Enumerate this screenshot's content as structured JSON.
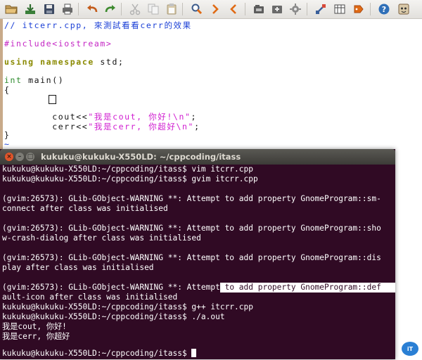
{
  "toolbar": {
    "icons": [
      "open-folder-icon",
      "download-icon",
      "save-icon",
      "print-icon",
      "undo-icon",
      "redo-icon",
      "cut-icon",
      "copy-icon",
      "paste-icon",
      "find-replace-icon",
      "find-next-icon",
      "find-prev-icon",
      "load-session-icon",
      "save-session-icon",
      "run-script-icon",
      "make-icon",
      "shell-icon",
      "ctags-icon",
      "help-icon",
      "vim-help-icon"
    ],
    "colors": {
      "undo": "#c35b1a",
      "find": "#e06a14",
      "help": "#2f6fb8"
    }
  },
  "editor": {
    "lines": {
      "comment": "// itcerr.cpp, 來測試看看cerr的效果",
      "include_kw": "#include",
      "include_hdr": "<iostream>",
      "using_kw": "using",
      "namespace_kw": "namespace",
      "std_text": " std;",
      "int_kw": "int",
      "main_sig": " main()",
      "open_brace": "{",
      "cout_prefix": "        cout<<",
      "cout_str": "\"我是cout, 你好!\\n\"",
      "semi": ";",
      "cerr_prefix": "        cerr<<",
      "cerr_str": "\"我是cerr, 你超好\\n\"",
      "close_brace": "}",
      "tilde": "~"
    }
  },
  "terminal": {
    "title": "kukuku@kukuku-X550LD: ~/cppcoding/itass",
    "lines": [
      "kukuku@kukuku-X550LD:~/cppcoding/itass$ vim itcrr.cpp",
      "kukuku@kukuku-X550LD:~/cppcoding/itass$ gvim itcrr.cpp",
      "",
      "(gvim:26573): GLib-GObject-WARNING **: Attempt to add property GnomeProgram::sm-",
      "connect after class was initialised",
      "",
      "(gvim:26573): GLib-GObject-WARNING **: Attempt to add property GnomeProgram::sho",
      "w-crash-dialog after class was initialised",
      "",
      "(gvim:26573): GLib-GObject-WARNING **: Attempt to add property GnomeProgram::dis",
      "play after class was initialised",
      "",
      "(gvim:26573): GLib-GObject-WARNING **: Attempt to add property GnomeProgram::def",
      "ault-icon after class was initialised",
      "kukuku@kukuku-X550LD:~/cppcoding/itass$ g++ itcrr.cpp",
      "kukuku@kukuku-X550LD:~/cppcoding/itass$ ./a.out",
      "我是cout, 你好!",
      "我是cerr, 你超好",
      "kukuku@kukuku-X550LD:~/cppcoding/itass$ "
    ],
    "selected_prefix": "(gvim:26573): GLib-GObject-WARNING **: Attempt",
    "selected_rest": " to add property GnomeProgram::def",
    "colors": {
      "background": "#300a24",
      "text": "#ffffff"
    }
  },
  "watermark": {
    "logo_icon": "ithome-logo-icon"
  }
}
